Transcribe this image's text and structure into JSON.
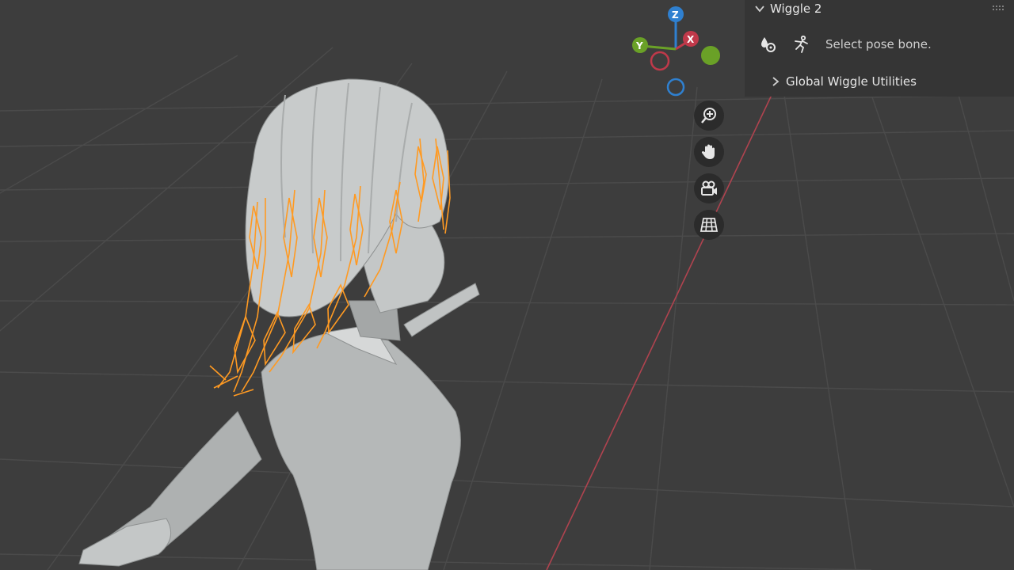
{
  "panel": {
    "title": "Wiggle 2",
    "status_text": "Select pose bone.",
    "subpanel_title": "Global Wiggle Utilities"
  },
  "gizmo": {
    "x_label": "X",
    "y_label": "Y",
    "z_label": "Z",
    "x_color": "#c0394a",
    "y_color": "#6aa127",
    "z_color": "#2f80d0"
  },
  "nav_tools": [
    {
      "icon": "zoom-icon"
    },
    {
      "icon": "pan-hand-icon"
    },
    {
      "icon": "camera-icon"
    },
    {
      "icon": "grid-orthographic-icon"
    }
  ],
  "colors": {
    "background": "#3d3d3d",
    "grid": "#4a4a4a",
    "x_axis_line": "#b0434f",
    "bones": "#ff9a22",
    "mesh": "#b9bcbc",
    "panel": "#353535"
  }
}
